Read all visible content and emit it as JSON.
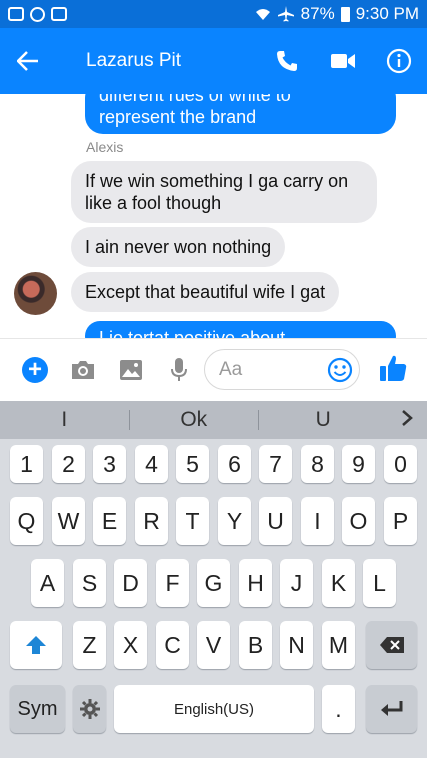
{
  "status_bar": {
    "battery": "87%",
    "time": "9:30 PM"
  },
  "header": {
    "title": "Lazarus Pit"
  },
  "messages": {
    "partial_outgoing_line1": "different rues of white to",
    "partial_outgoing_line2": "represent the brand",
    "sender_name": "Alexis",
    "incoming": [
      "If we win something I ga carry on like a fool though",
      "I ain never won nothing",
      "Except that beautiful wife I gat"
    ],
    "partial_outgoing_bottom": "Lie tortat positive about"
  },
  "composer": {
    "placeholder": "Aa"
  },
  "keyboard": {
    "suggestions": [
      "I",
      "Ok",
      "U"
    ],
    "number_row": [
      "1",
      "2",
      "3",
      "4",
      "5",
      "6",
      "7",
      "8",
      "9",
      "0"
    ],
    "row1": [
      "Q",
      "W",
      "E",
      "R",
      "T",
      "Y",
      "U",
      "I",
      "O",
      "P"
    ],
    "row2": [
      "A",
      "S",
      "D",
      "F",
      "G",
      "H",
      "J",
      "K",
      "L"
    ],
    "row3": [
      "Z",
      "X",
      "C",
      "V",
      "B",
      "N",
      "M"
    ],
    "sym_label": "Sym",
    "space_label": "English(US)",
    "period_label": "."
  },
  "colors": {
    "accent": "#0a84ff",
    "status_bar": "#0a6fd8",
    "incoming_bubble": "#e9e9ec",
    "keyboard_bg": "#d8dbe0"
  }
}
